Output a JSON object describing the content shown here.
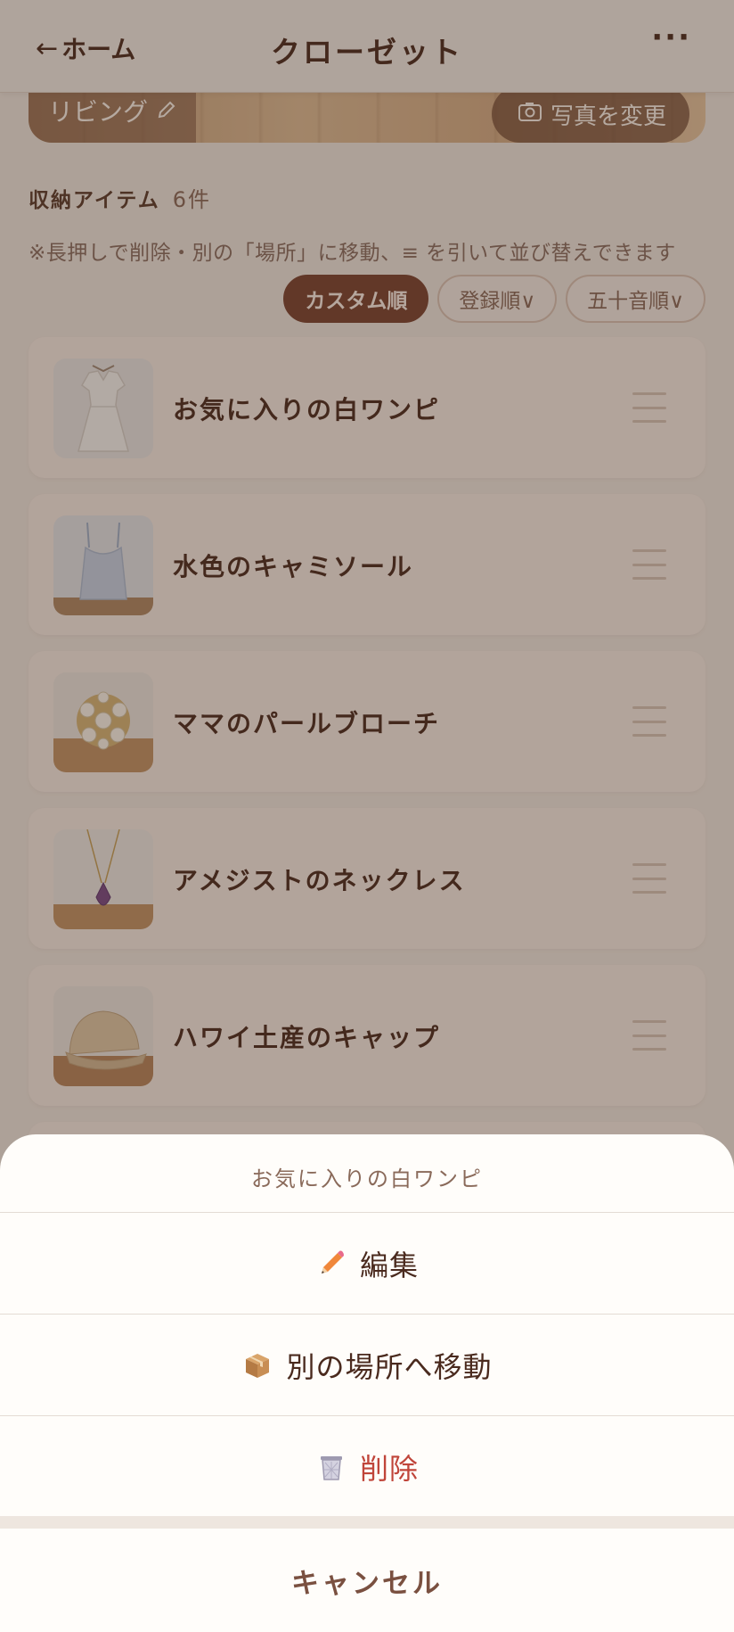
{
  "header": {
    "back_arrow": "←",
    "back_label": "ホーム",
    "title": "クローゼット",
    "more": "···"
  },
  "location_banner": {
    "name": "リビング",
    "edit_icon": "pencil-icon",
    "change_photo_label": "写真を変更",
    "change_photo_icon": "camera-icon"
  },
  "section": {
    "title": "収納アイテム",
    "count": "6件",
    "hint": "※長押しで削除・別の「場所」に移動、≡ を引いて並び替えできます"
  },
  "sort_options": [
    {
      "label": "カスタム順",
      "active": true
    },
    {
      "label": "登録順∨",
      "active": false
    },
    {
      "label": "五十音順∨",
      "active": false
    }
  ],
  "items": [
    {
      "name": "お気に入りの白ワンピ",
      "thumb": "white-dress"
    },
    {
      "name": "水色のキャミソール",
      "thumb": "camisole"
    },
    {
      "name": "ママのパールブローチ",
      "thumb": "pearl-brooch"
    },
    {
      "name": "アメジストのネックレス",
      "thumb": "amethyst-necklace"
    },
    {
      "name": "ハワイ土産のキャップ",
      "thumb": "cap"
    }
  ],
  "action_sheet": {
    "title": "お気に入りの白ワンピ",
    "options": [
      {
        "label": "編集",
        "icon": "pencil-icon"
      },
      {
        "label": "別の場所へ移動",
        "icon": "package-icon"
      },
      {
        "label": "削除",
        "icon": "trash-icon"
      }
    ],
    "cancel_label": "キャンセル"
  },
  "colors": {
    "accent": "#7a4330",
    "danger": "#c0453a",
    "card_bg": "#fbf0e8"
  }
}
